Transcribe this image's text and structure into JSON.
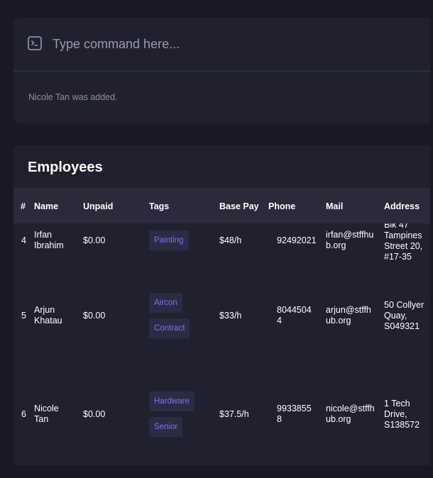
{
  "command": {
    "placeholder": "Type command here...",
    "result": "Nicole Tan was added."
  },
  "employees": {
    "title": "Employees",
    "columns": [
      "#",
      "Name",
      "Unpaid",
      "Tags",
      "Base Pay",
      "Phone",
      "Mail",
      "Address"
    ],
    "rows": [
      {
        "index": "4",
        "name": [
          "Irfan",
          "Ibrahim"
        ],
        "unpaid": "$0.00",
        "tags": [
          "Painting"
        ],
        "base_pay": "$48/h",
        "phone": [
          "92492021"
        ],
        "mail": [
          "irfan@stffhu",
          "b.org"
        ],
        "address": [
          "Blk 47",
          "Tampines",
          "Street 20,",
          "#17-35"
        ]
      },
      {
        "index": "5",
        "name": [
          "Arjun",
          "Khatau"
        ],
        "unpaid": "$0.00",
        "tags": [
          "Aircon",
          "Contract"
        ],
        "base_pay": "$33/h",
        "phone": [
          "8044504",
          "4"
        ],
        "mail": [
          "arjun@stffh",
          "ub.org"
        ],
        "address": [
          "50 Collyer",
          "Quay,",
          "S049321"
        ]
      },
      {
        "index": "6",
        "name": [
          "Nicole",
          "Tan"
        ],
        "unpaid": "$0.00",
        "tags": [
          "Hardware",
          "Senior"
        ],
        "base_pay": "$37.5/h",
        "phone": [
          "9933855",
          "8"
        ],
        "mail": [
          "nicole@stffh",
          "ub.org"
        ],
        "address": [
          "1 Tech",
          "Drive,",
          "S138572"
        ]
      }
    ]
  },
  "colors": {
    "background": "#181826",
    "card": "#20202f",
    "header": "#2a2a3b",
    "tag_bg": "#2b2b44",
    "tag_text": "#7b76e8"
  }
}
